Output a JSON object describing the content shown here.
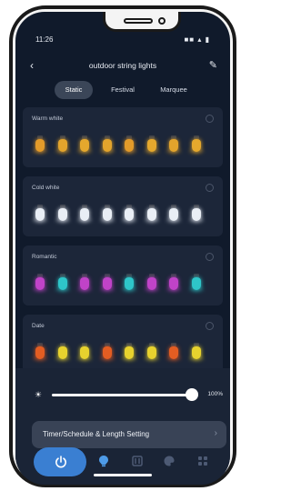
{
  "status_bar": {
    "time": "11:26",
    "icons": "■■ ▴ ▮"
  },
  "nav": {
    "back": "‹",
    "title": "outdoor string lights",
    "edit": "✎"
  },
  "tabs": [
    {
      "label": "Static",
      "active": true
    },
    {
      "label": "Festival",
      "active": false
    },
    {
      "label": "Marquee",
      "active": false
    }
  ],
  "scenes": [
    {
      "label": "Warm white",
      "bulbs": [
        "#e39b2a",
        "#e3a42c",
        "#e5a82d",
        "#e3a42c",
        "#e39b2a",
        "#e5a82d",
        "#e3a42c",
        "#e5a82d"
      ]
    },
    {
      "label": "Cold white",
      "bulbs": [
        "#e9eef5",
        "#e9eef5",
        "#e9eef5",
        "#e9eef5",
        "#e9eef5",
        "#e9eef5",
        "#e9eef5",
        "#e9eef5"
      ]
    },
    {
      "label": "Romantic",
      "bulbs": [
        "#c043c8",
        "#2ec6c9",
        "#c043c8",
        "#c043c8",
        "#2ec6c9",
        "#c043c8",
        "#c043c8",
        "#2ec6c9"
      ]
    },
    {
      "label": "Date",
      "bulbs": [
        "#e35d22",
        "#e7d22e",
        "#e7d22e",
        "#e35d22",
        "#e7d22e",
        "#e7d22e",
        "#e35d22",
        "#e7d22e"
      ]
    }
  ],
  "brightness": {
    "value_label": "100%",
    "value": 1.0
  },
  "timer": {
    "label": "Timer/Schedule & Length Setting",
    "chevron": "›"
  },
  "dock": {
    "icons": [
      "power-icon",
      "bulb-icon",
      "music-icon",
      "palette-icon",
      "grid-icon"
    ],
    "accent": "#3a7fd2"
  }
}
